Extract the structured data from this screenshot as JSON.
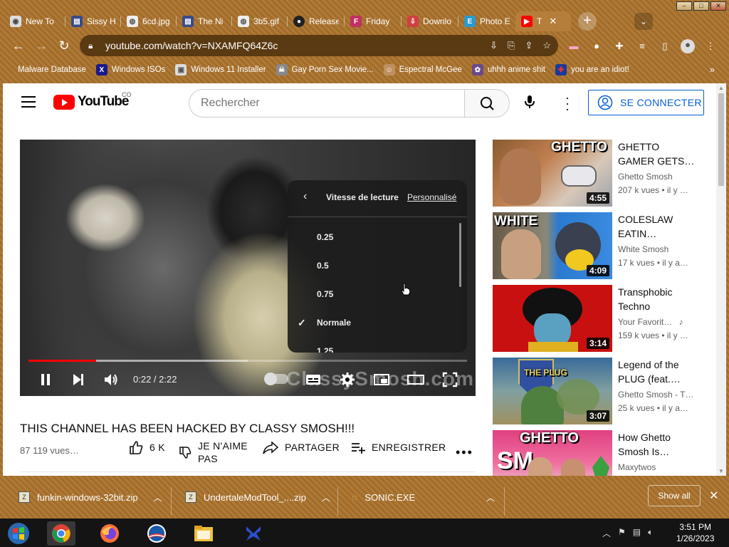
{
  "browser": {
    "tabs": [
      {
        "label": "New To",
        "favicon": "chrome-icon",
        "color": "#5a5a5a"
      },
      {
        "label": "Sissy H",
        "favicon": "page-icon",
        "color": "#3a4a8a"
      },
      {
        "label": "6cd.jpg",
        "favicon": "globe-icon",
        "color": "#5a5a5a"
      },
      {
        "label": "The Ni",
        "favicon": "page-icon",
        "color": "#3a4a8a"
      },
      {
        "label": "3b5.gif",
        "favicon": "globe-icon",
        "color": "#5a5a5a"
      },
      {
        "label": "Release",
        "favicon": "github-icon",
        "color": "#222"
      },
      {
        "label": "Friday",
        "favicon": "fnf-icon",
        "color": "#c03060"
      },
      {
        "label": "Downlo",
        "favicon": "download-icon",
        "color": "#d04040"
      },
      {
        "label": "Photo E",
        "favicon": "photo-editor-icon",
        "color": "#2a9ad0"
      },
      {
        "label": "T",
        "favicon": "youtube-icon",
        "color": "#ff0000"
      }
    ],
    "url": "youtube.com/watch?v=NXAMFQ64Z6c",
    "bookmarks": [
      {
        "label": "Malware Database",
        "icon": "folder-icon"
      },
      {
        "label": "Windows ISOs",
        "icon": "x-icon"
      },
      {
        "label": "Windows 11 Installer",
        "icon": "image-icon"
      },
      {
        "label": "Gay Porn Sex Movie...",
        "icon": "skull-icon"
      },
      {
        "label": "Espectral McGee",
        "icon": "avatar-icon"
      },
      {
        "label": "uhhh anime shit",
        "icon": "anime-icon"
      },
      {
        "label": "you are an idiot!",
        "icon": "flag-icon"
      }
    ]
  },
  "youtube": {
    "logo_text": "YouTube",
    "country": "CO",
    "search_placeholder": "Rechercher",
    "signin_label": "SE CONNECTER",
    "player": {
      "time": "0:22 / 2:22",
      "progress": 0.155,
      "watermark": "ClassySmosh.com",
      "speed_menu": {
        "title": "Vitesse de lecture",
        "custom": "Personnalisé",
        "options": [
          "0.25",
          "0.5",
          "0.75",
          "Normale",
          "1.25"
        ],
        "selected": "Normale"
      }
    },
    "video": {
      "title": "THIS CHANNEL HAS BEEN HACKED BY CLASSY SMOSH!!!",
      "views": "87 119 vues…",
      "likes": "6 K",
      "dislike_label_1": "JE N'AIME",
      "dislike_label_2": "PAS",
      "share_label": "PARTAGER",
      "save_label": "ENREGISTRER"
    },
    "recommendations": [
      {
        "title": "GHETTO GAMER GETS…",
        "channel": "Ghetto Smosh",
        "meta": "207 k vues  • il y …",
        "duration": "4:55",
        "thumb_text": "GHETTO"
      },
      {
        "title": "COLESLAW EATIN…",
        "channel": "White Smosh",
        "meta": "17 k vues  • il y a…",
        "duration": "4:09",
        "thumb_text": "WHITE"
      },
      {
        "title": "Transphobic Techno",
        "channel": "Your Favorit…",
        "meta": "159 k vues  • il y …",
        "duration": "3:14",
        "thumb_text": ""
      },
      {
        "title": "Legend of the PLUG (feat.…",
        "channel": "Ghetto Smosh - T…",
        "meta": "25 k vues  • il y a…",
        "duration": "3:07",
        "thumb_text": "THE PLUG"
      },
      {
        "title": "How Ghetto Smosh Is…",
        "channel": "Maxytwos",
        "meta": "",
        "duration": "",
        "thumb_text": "GHETTO"
      }
    ]
  },
  "downloads": [
    {
      "name": "funkin-windows-32bit.zip"
    },
    {
      "name": "UndertaleModTool_....zip"
    },
    {
      "name": "SONIC.EXE"
    }
  ],
  "download_show_all": "Show all",
  "taskbar": {
    "time": "3:51 PM",
    "date": "1/26/2023"
  }
}
